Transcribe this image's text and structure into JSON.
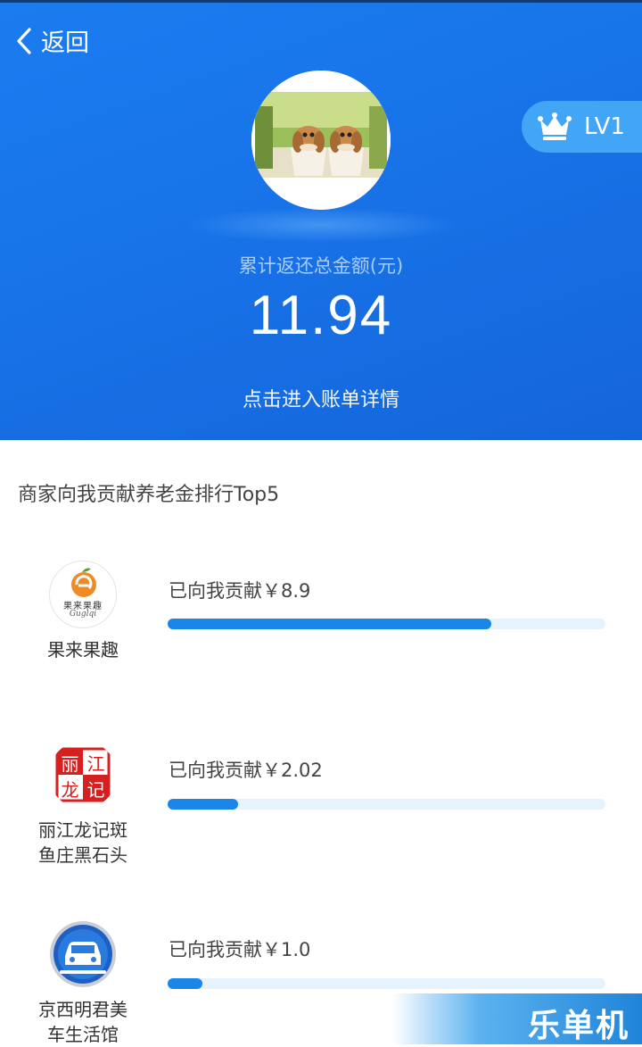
{
  "header": {
    "back_label": "返回",
    "level": "LV1",
    "total_label": "累计返还总金额(元)",
    "total_value": "11.94",
    "bill_link": "点击进入账单详情"
  },
  "ranking": {
    "title": "商家向我贡献养老金排行Top5",
    "items": [
      {
        "name": "果来果趣",
        "contribution": "已向我贡献￥8.9",
        "logo_text": "果来果趣",
        "logo_sub": "Guglqi",
        "progress": 0.74
      },
      {
        "name": "丽江龙记斑\n鱼庄黑石头",
        "name_line1": "丽江龙记斑",
        "name_line2": "鱼庄黑石头",
        "contribution": "已向我贡献￥2.02",
        "logo_chars": [
          "丽",
          "江",
          "龙",
          "记"
        ],
        "progress": 0.16
      },
      {
        "name": "京西明君美\n车生活馆",
        "name_line1": "京西明君美",
        "name_line2": "车生活馆",
        "contribution": "已向我贡献￥1.0",
        "progress": 0.08
      }
    ]
  },
  "watermark": "乐单机",
  "colors": {
    "primary": "#1a7cf0",
    "bar": "#1a86e8",
    "track": "#e6f2fc",
    "level_badge": "#42a5f5"
  }
}
